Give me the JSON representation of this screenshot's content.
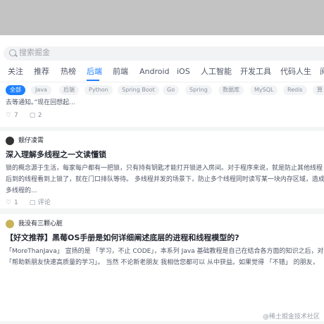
{
  "search": {
    "placeholder": "搜索掘金"
  },
  "nav_tabs": [
    "关注",
    "推荐",
    "热榜",
    "后端",
    "前端",
    "Android",
    "iOS",
    "人工智能",
    "开发工具",
    "代码人生",
    "阅"
  ],
  "active_tab": "后端",
  "tags": [
    "全部",
    "Java",
    "后端",
    "Python",
    "Spring Boot",
    "Go",
    "Spring",
    "数据库",
    "MySQL",
    "Redis",
    "算"
  ],
  "feed": [
    {
      "excerpt": [
        "去等通知。”现在回想起..."
      ],
      "likes": "7",
      "comments": "2"
    },
    {
      "author": "靓仔凌霄",
      "title": "深入理解多线程之一文读懂锁",
      "excerpt": [
        "锁的概念源于生活，每家每户都有一把锁，只有持有钥匙才能打开锁进入房间。对于程序来说，就是防止其他线程",
        "后到的线程看到上锁了，就在门口排队等待。 多线程并发的场景下，防止多个线程同时读写某一块内存区域，造成",
        "多线程的..."
      ],
      "likes": "1",
      "comments": "评论"
    },
    {
      "author": "我没有三颗心脏",
      "title": "【好文推荐】黑莓OS手册是如何详细阐述底层的进程和线程模型的?",
      "excerpt": [
        "「MoreThanJava」 宣扬的是 「学习，不止 CODE」，本系列 Java 基础教程是自己在结合各方面的知识之后，对",
        "「帮助新朋友快速高质量的学习」。 当然 不论新老朋友 我相信您都可以 从中获益。如果觉得 「不错」 的朋友，"
      ]
    }
  ],
  "watermark": "@稀土掘金技术社区",
  "colors": {
    "accent": "#1e80ff",
    "topbar": "#c3c3c3"
  }
}
